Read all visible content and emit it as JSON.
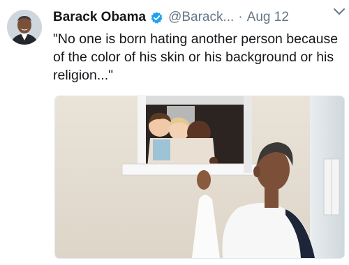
{
  "tweet": {
    "author_name": "Barack Obama",
    "verified_icon": "verified-badge-icon",
    "handle": "@Barack...",
    "separator": "·",
    "date": "Aug 12",
    "menu_icon": "chevron-down-icon",
    "text": "\"No one is born hating another person because of the color of his skin or his background or his religion...\"",
    "colors": {
      "text": "#14171a",
      "secondary": "#657786",
      "verified": "#1da1f2"
    }
  }
}
